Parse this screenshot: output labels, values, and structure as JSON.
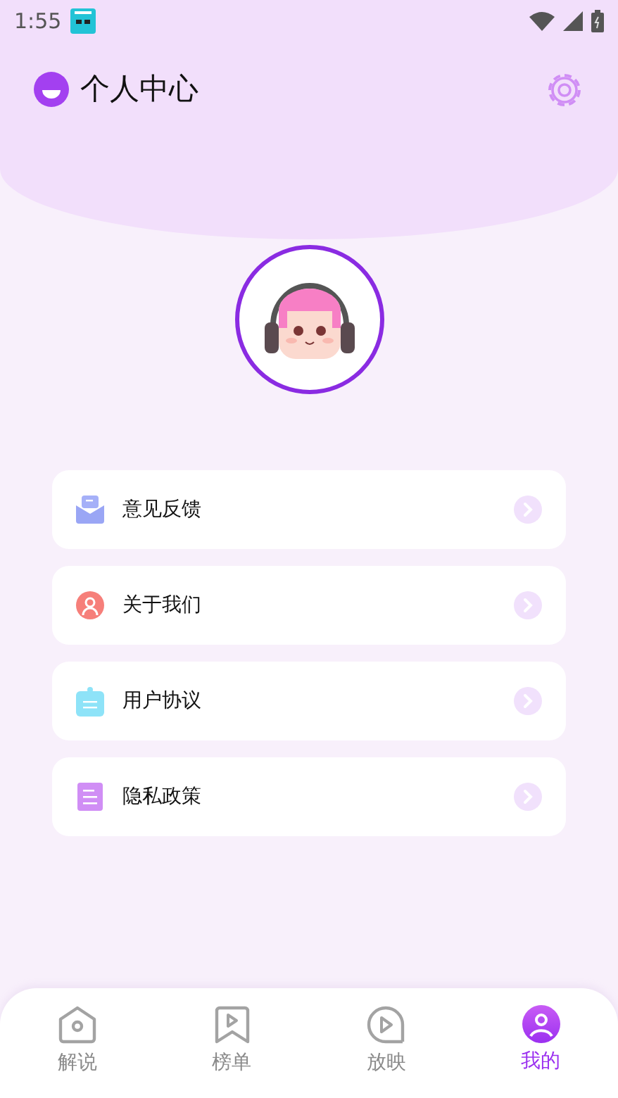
{
  "status_bar": {
    "time": "1:55"
  },
  "header": {
    "title": "个人中心"
  },
  "menu": [
    {
      "kind": "feedback",
      "label": "意见反馈"
    },
    {
      "kind": "about",
      "label": "关于我们"
    },
    {
      "kind": "agreement",
      "label": "用户协议"
    },
    {
      "kind": "privacy",
      "label": "隐私政策"
    }
  ],
  "tabs": [
    {
      "kind": "home",
      "label": "解说",
      "selected": false
    },
    {
      "kind": "bookmark",
      "label": "榜单",
      "selected": false
    },
    {
      "kind": "play",
      "label": "放映",
      "selected": false
    },
    {
      "kind": "user",
      "label": "我的",
      "selected": true
    }
  ]
}
